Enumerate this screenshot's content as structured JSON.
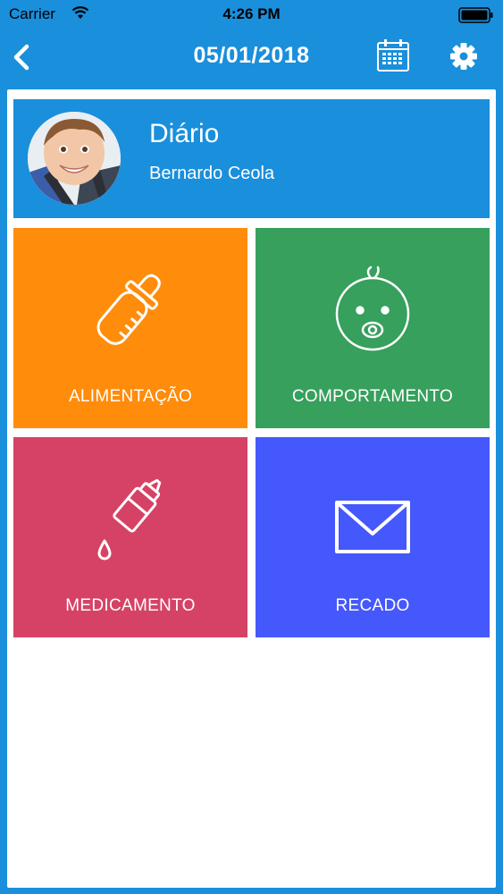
{
  "status_bar": {
    "carrier": "Carrier",
    "time": "4:26 PM"
  },
  "nav": {
    "title": "05/01/2018",
    "back_icon": "chevron-left-icon",
    "calendar_icon": "calendar-icon",
    "settings_icon": "gear-icon"
  },
  "profile": {
    "title": "Diário",
    "name": "Bernardo Ceola"
  },
  "tiles": [
    {
      "label": "ALIMENTAÇÃO",
      "color": "#ff8c0a",
      "icon": "baby-bottle-icon"
    },
    {
      "label": "COMPORTAMENTO",
      "color": "#36a05c",
      "icon": "baby-face-icon"
    },
    {
      "label": "MEDICAMENTO",
      "color": "#d64265",
      "icon": "medicine-dropper-icon"
    },
    {
      "label": "RECADO",
      "color": "#4558fb",
      "icon": "envelope-icon"
    }
  ],
  "colors": {
    "header_blue": "#1a8fdc",
    "content_bg": "#ffffff"
  }
}
